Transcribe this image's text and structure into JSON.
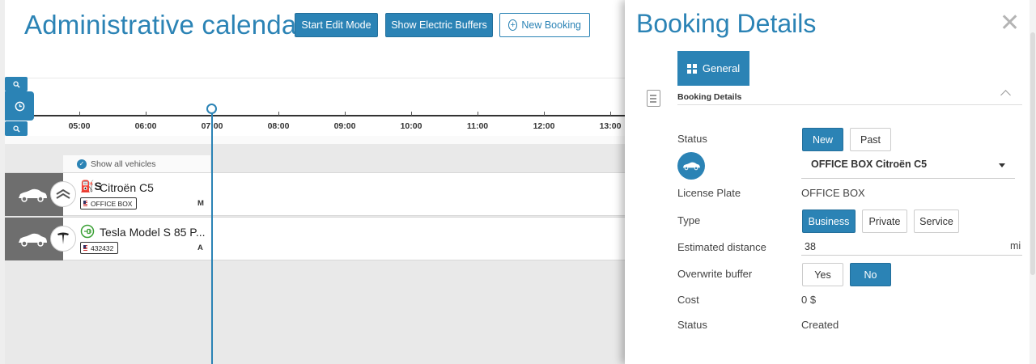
{
  "calendar": {
    "title": "Administrative calendar",
    "buttons": {
      "start_edit": "Start Edit Mode",
      "electric_buffers": "Show Electric Buffers",
      "new_booking": "New Booking"
    },
    "hours": [
      "05:00",
      "06:00",
      "07:00",
      "08:00",
      "09:00",
      "10:00",
      "11:00",
      "12:00",
      "13:00"
    ],
    "show_all_vehicles": "Show all vehicles",
    "vehicles": [
      {
        "name": "Citroën C5",
        "prefix": "S",
        "plate": "OFFICE BOX",
        "size": "M",
        "brand_icon": "citroen-logo-icon"
      },
      {
        "name": "Tesla Model S 85 P...",
        "prefix": "",
        "plate": "432432",
        "size": "A",
        "brand_icon": "tesla-logo-icon"
      }
    ]
  },
  "panel": {
    "title": "Booking Details",
    "tab_general": "General",
    "section_title": "Booking Details",
    "status": {
      "label": "Status",
      "options": [
        "New",
        "Past"
      ],
      "selected": "New"
    },
    "vehicle_select": "OFFICE BOX Citroën C5",
    "license_plate": {
      "label": "License Plate",
      "value": "OFFICE BOX"
    },
    "type": {
      "label": "Type",
      "options": [
        "Business",
        "Private",
        "Service"
      ],
      "selected": "Business"
    },
    "estimated_distance": {
      "label": "Estimated distance",
      "value": "38",
      "unit": "mi"
    },
    "overwrite_buffer": {
      "label": "Overwrite buffer",
      "options": [
        "Yes",
        "No"
      ],
      "selected": "No"
    },
    "cost": {
      "label": "Cost",
      "value": "0 $"
    },
    "status2": {
      "label": "Status",
      "value": "Created"
    }
  },
  "colors": {
    "accent": "#2b83b5",
    "close": "#b4b4b4",
    "grid": "#e9e9e9",
    "thumb": "#6e6e6e"
  }
}
